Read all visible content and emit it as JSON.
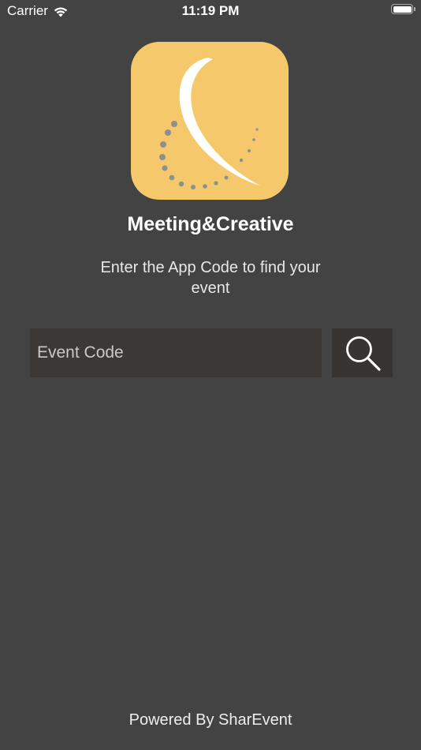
{
  "status_bar": {
    "carrier": "Carrier",
    "time": "11:19 PM",
    "icons": [
      "wifi-icon",
      "battery-icon"
    ]
  },
  "app": {
    "name": "Meeting&Creative",
    "logo_color": "#f5c96b"
  },
  "instruction": "Enter the App Code to find your event",
  "search": {
    "placeholder": "Event Code",
    "value": "",
    "button_icon": "search-icon"
  },
  "footer": "Powered By SharEvent",
  "colors": {
    "background": "#434343",
    "input_background": "#3b3836",
    "accent": "#f5c96b"
  }
}
